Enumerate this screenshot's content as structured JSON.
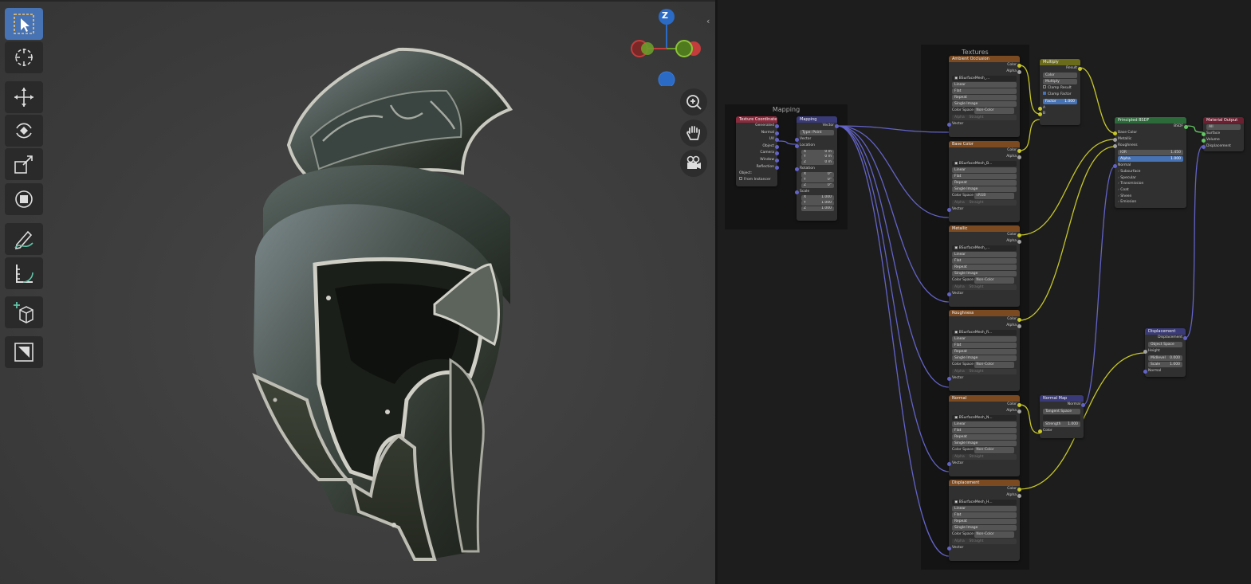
{
  "viewport": {
    "toolbar": [
      {
        "name": "select-box-tool",
        "icon": "select-box-icon",
        "active": true
      },
      {
        "name": "cursor-tool",
        "icon": "cursor-icon",
        "active": false
      },
      {
        "name": "move-tool",
        "icon": "move-icon",
        "active": false
      },
      {
        "name": "rotate-tool",
        "icon": "rotate-icon",
        "active": false
      },
      {
        "name": "scale-tool",
        "icon": "scale-icon",
        "active": false
      },
      {
        "name": "transform-tool",
        "icon": "transform-icon",
        "active": false
      },
      {
        "name": "annotate-tool",
        "icon": "annotate-icon",
        "active": false
      },
      {
        "name": "measure-tool",
        "icon": "measure-icon",
        "active": false
      },
      {
        "name": "add-cube-tool",
        "icon": "add-cube-icon",
        "active": false
      },
      {
        "name": "dissolve-tool",
        "icon": "dissolve-icon",
        "active": false
      }
    ],
    "gizmo": {
      "z_label": "Z",
      "colors": {
        "x": "#c43c3c",
        "y": "#6b9c2a",
        "z": "#2b6bc5"
      }
    },
    "nav": [
      "zoom-icon",
      "hand-icon",
      "camera-icon"
    ]
  },
  "node_editor": {
    "frames": {
      "mapping": "Mapping",
      "textures": "Textures"
    },
    "texture_coordinate": {
      "title": "Texture Coordinate",
      "outputs": [
        "Generated",
        "Normal",
        "UV",
        "Object",
        "Camera",
        "Window",
        "Reflection"
      ],
      "object_label": "Object:",
      "from_instancer": "From Instancer"
    },
    "mapping": {
      "title": "Mapping",
      "out": "Vector",
      "type_label": "Type:",
      "type_value": "Point",
      "vector": "Vector",
      "location": "Location",
      "loc": [
        [
          "X",
          "0 m"
        ],
        [
          "Y",
          "0 m"
        ],
        [
          "Z",
          "0 m"
        ]
      ],
      "rotation": "Rotation",
      "rot": [
        [
          "X",
          "0°"
        ],
        [
          "Y",
          "0°"
        ],
        [
          "Z",
          "0°"
        ]
      ],
      "scale": "Scale",
      "scl": [
        [
          "X",
          "1.000"
        ],
        [
          "Y",
          "1.000"
        ],
        [
          "Z",
          "1.000"
        ]
      ]
    },
    "image_textures": [
      {
        "title": "Ambient Occlusion",
        "image": "BSurfaceMesh_...",
        "colorspace": "Non-Color",
        "alpha": "Straight"
      },
      {
        "title": "Base Color",
        "image": "BSurfaceMesh_B...",
        "colorspace": "sRGB",
        "alpha": "Straight"
      },
      {
        "title": "Metallic",
        "image": "BSurfaceMesh_...",
        "colorspace": "Non-Color",
        "alpha": "Straight"
      },
      {
        "title": "Roughness",
        "image": "BSurfaceMesh_R...",
        "colorspace": "Non-Color",
        "alpha": "Straight"
      },
      {
        "title": "Normal",
        "image": "BSurfaceMesh_N...",
        "colorspace": "Non-Color",
        "alpha": "Straight"
      },
      {
        "title": "Displacement",
        "image": "BSurfaceMesh_H...",
        "colorspace": "Non-Color",
        "alpha": "Straight"
      }
    ],
    "tex_common": {
      "color": "Color",
      "alpha": "Alpha",
      "interp": "Linear",
      "proj": "Flat",
      "ext": "Repeat",
      "source": "Single Image",
      "cs_label": "Color Space",
      "alpha_label": "Alpha",
      "vector": "Vector"
    },
    "multiply": {
      "title": "Multiply",
      "result": "Result",
      "mode1": "Color",
      "mode2": "Multiply",
      "clamp_result": "Clamp Result",
      "clamp_factor": "Clamp Factor",
      "factor_label": "Factor",
      "factor_value": "1.000",
      "a": "A",
      "b": "B"
    },
    "bsdf": {
      "title": "Principled BSDF",
      "out": "BSDF",
      "base": "Base Color",
      "metallic": "Metallic",
      "roughness": "Roughness",
      "ior_label": "IOR",
      "ior_value": "1.450",
      "alpha_label": "Alpha",
      "alpha_value": "1.000",
      "normal": "Normal",
      "subs": [
        "Subsurface",
        "Specular",
        "Transmission",
        "Coat",
        "Sheen",
        "Emission"
      ]
    },
    "output": {
      "title": "Material Output",
      "target": "All",
      "surface": "Surface",
      "volume": "Volume",
      "displacement": "Displacement"
    },
    "displacement": {
      "title": "Displacement",
      "out": "Displacement",
      "space": "Object Space",
      "height": "Height",
      "midlevel_label": "Midlevel",
      "midlevel_value": "0.000",
      "scale_label": "Scale",
      "scale_value": "1.000",
      "normal": "Normal"
    },
    "normal_map": {
      "title": "Normal Map",
      "out": "Normal",
      "space": "Tangent Space",
      "uv": "",
      "strength_label": "Strength",
      "strength_value": "1.000",
      "color": "Color"
    }
  }
}
